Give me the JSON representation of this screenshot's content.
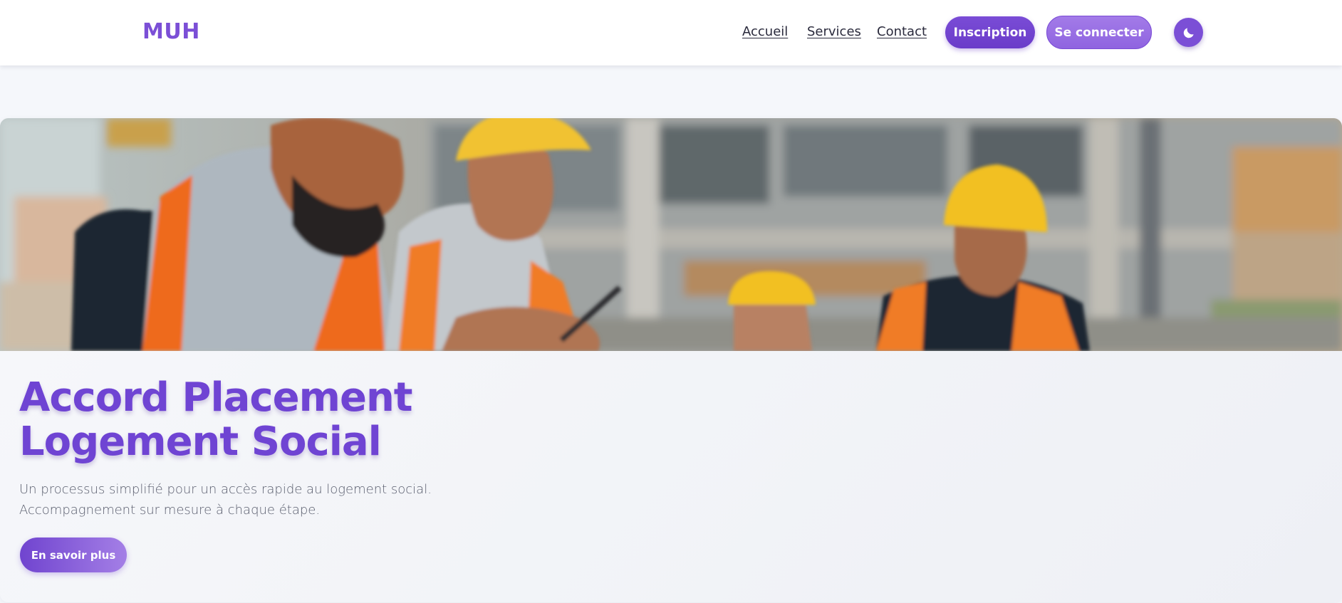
{
  "header": {
    "logo": "MUH",
    "nav": {
      "home": "Accueil",
      "services": "Services",
      "contact": "Contact"
    },
    "signup_label": "Inscription",
    "login_label": "Se connecter",
    "theme_icon": "moon-icon"
  },
  "hero": {
    "image_icon": "construction-workers-photo",
    "title_line1": "Accord Placement",
    "title_line2": "Logement Social",
    "subtitle_line1": "Un processus simplifié pour un accès rapide au logement social.",
    "subtitle_line2": "Accompagnement sur mesure à chaque étape.",
    "cta_label": "En savoir plus"
  },
  "colors": {
    "accent": "#7b4fd6",
    "accent_light": "#a37be8",
    "background": "#f5f7fb"
  }
}
